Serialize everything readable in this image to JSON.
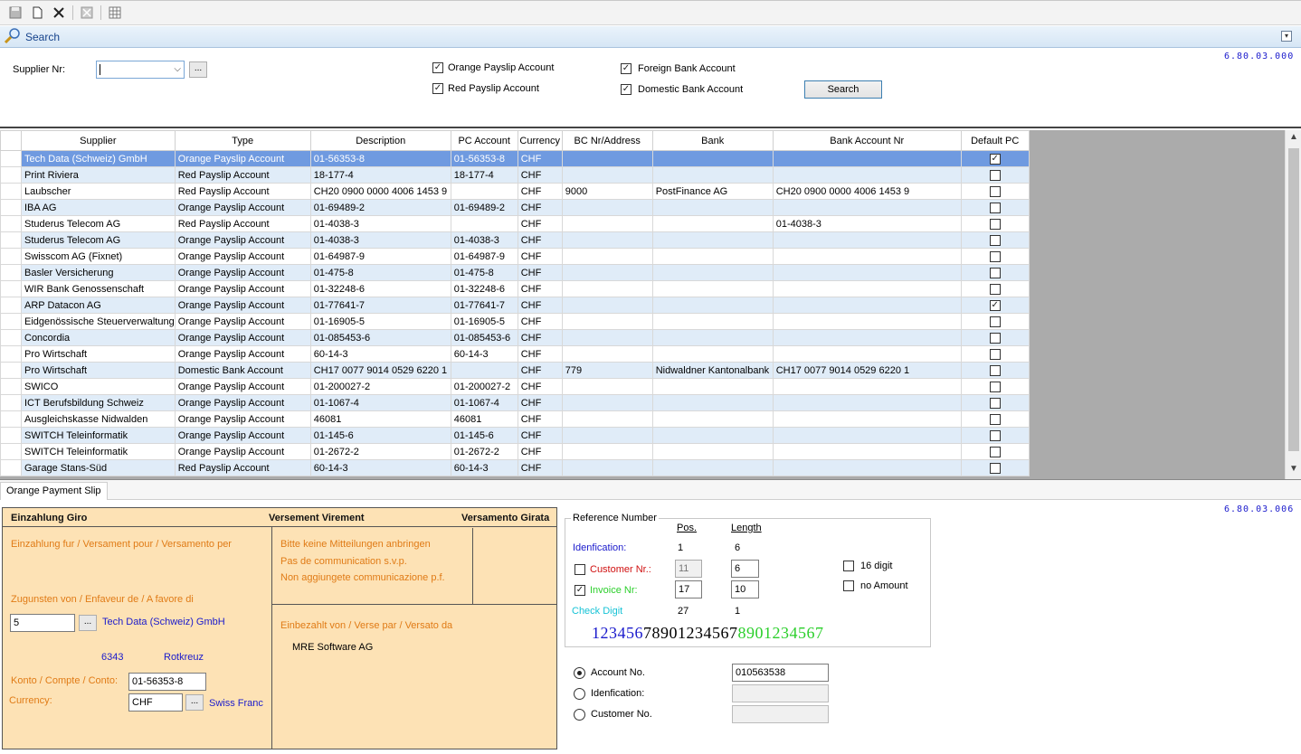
{
  "toolbar": {
    "icons": [
      "save-icon",
      "new-document-icon",
      "delete-icon",
      "cancel-icon",
      "grid-icon"
    ]
  },
  "search": {
    "title": "Search",
    "version": "6.80.03.000",
    "supplier_label": "Supplier Nr:",
    "supplier_value": "",
    "dots": "...",
    "options": [
      {
        "label": "Orange Payslip Account",
        "checked": true
      },
      {
        "label": "Red Payslip Account",
        "checked": true
      },
      {
        "label": "Foreign Bank Account",
        "checked": true
      },
      {
        "label": "Domestic Bank Account",
        "checked": true
      }
    ],
    "search_button": "Search"
  },
  "grid": {
    "columns": [
      "Supplier",
      "Type",
      "Description",
      "PC Account",
      "Currency",
      "BC Nr/Address",
      "Bank",
      "Bank Account Nr",
      "Default PC"
    ],
    "rows": [
      {
        "supplier": "Tech Data (Schweiz) GmbH",
        "type": "Orange Payslip Account",
        "description": "01-56353-8",
        "pc": "01-56353-8",
        "currency": "CHF",
        "bc": "",
        "bank": "",
        "bank_acc": "",
        "default": true
      },
      {
        "supplier": "Print Riviera",
        "type": "Red Payslip Account",
        "description": "18-177-4",
        "pc": "18-177-4",
        "currency": "CHF",
        "bc": "",
        "bank": "",
        "bank_acc": "",
        "default": false
      },
      {
        "supplier": "Laubscher",
        "type": "Red Payslip Account",
        "description": "CH20 0900 0000 4006 1453 9",
        "pc": "",
        "currency": "CHF",
        "bc": "9000",
        "bank": "PostFinance AG",
        "bank_acc": "CH20 0900 0000 4006 1453 9",
        "default": false
      },
      {
        "supplier": "IBA AG",
        "type": "Orange Payslip Account",
        "description": "01-69489-2",
        "pc": "01-69489-2",
        "currency": "CHF",
        "bc": "",
        "bank": "",
        "bank_acc": "",
        "default": false
      },
      {
        "supplier": "Studerus Telecom AG",
        "type": "Red Payslip Account",
        "description": "01-4038-3",
        "pc": "",
        "currency": "CHF",
        "bc": "",
        "bank": "",
        "bank_acc": "01-4038-3",
        "default": false
      },
      {
        "supplier": "Studerus Telecom AG",
        "type": "Orange Payslip Account",
        "description": "01-4038-3",
        "pc": "01-4038-3",
        "currency": "CHF",
        "bc": "",
        "bank": "",
        "bank_acc": "",
        "default": false
      },
      {
        "supplier": "Swisscom AG (Fixnet)",
        "type": "Orange Payslip Account",
        "description": "01-64987-9",
        "pc": "01-64987-9",
        "currency": "CHF",
        "bc": "",
        "bank": "",
        "bank_acc": "",
        "default": false
      },
      {
        "supplier": "Basler Versicherung",
        "type": "Orange Payslip Account",
        "description": "01-475-8",
        "pc": "01-475-8",
        "currency": "CHF",
        "bc": "",
        "bank": "",
        "bank_acc": "",
        "default": false
      },
      {
        "supplier": "WIR Bank Genossenschaft",
        "type": "Orange Payslip Account",
        "description": "01-32248-6",
        "pc": "01-32248-6",
        "currency": "CHF",
        "bc": "",
        "bank": "",
        "bank_acc": "",
        "default": false
      },
      {
        "supplier": "ARP Datacon AG",
        "type": "Orange Payslip Account",
        "description": "01-77641-7",
        "pc": "01-77641-7",
        "currency": "CHF",
        "bc": "",
        "bank": "",
        "bank_acc": "",
        "default": true
      },
      {
        "supplier": "Eidgenössische Steuerverwaltung",
        "type": "Orange Payslip Account",
        "description": "01-16905-5",
        "pc": "01-16905-5",
        "currency": "CHF",
        "bc": "",
        "bank": "",
        "bank_acc": "",
        "default": false
      },
      {
        "supplier": "Concordia",
        "type": "Orange Payslip Account",
        "description": "01-085453-6",
        "pc": "01-085453-6",
        "currency": "CHF",
        "bc": "",
        "bank": "",
        "bank_acc": "",
        "default": false
      },
      {
        "supplier": "Pro Wirtschaft",
        "type": "Orange Payslip Account",
        "description": "60-14-3",
        "pc": "60-14-3",
        "currency": "CHF",
        "bc": "",
        "bank": "",
        "bank_acc": "",
        "default": false
      },
      {
        "supplier": "Pro Wirtschaft",
        "type": "Domestic Bank Account",
        "description": "CH17 0077 9014 0529 6220 1",
        "pc": "",
        "currency": "CHF",
        "bc": "779",
        "bank": "Nidwaldner Kantonalbank",
        "bank_acc": "CH17 0077 9014 0529 6220 1",
        "default": false
      },
      {
        "supplier": "SWICO",
        "type": "Orange Payslip Account",
        "description": "01-200027-2",
        "pc": "01-200027-2",
        "currency": "CHF",
        "bc": "",
        "bank": "",
        "bank_acc": "",
        "default": false
      },
      {
        "supplier": "ICT Berufsbildung Schweiz",
        "type": "Orange Payslip Account",
        "description": "01-1067-4",
        "pc": "01-1067-4",
        "currency": "CHF",
        "bc": "",
        "bank": "",
        "bank_acc": "",
        "default": false
      },
      {
        "supplier": "Ausgleichskasse Nidwalden",
        "type": "Orange Payslip Account",
        "description": "46081",
        "pc": "46081",
        "currency": "CHF",
        "bc": "",
        "bank": "",
        "bank_acc": "",
        "default": false
      },
      {
        "supplier": "SWITCH Teleinformatik",
        "type": "Orange Payslip Account",
        "description": "01-145-6",
        "pc": "01-145-6",
        "currency": "CHF",
        "bc": "",
        "bank": "",
        "bank_acc": "",
        "default": false
      },
      {
        "supplier": "SWITCH Teleinformatik",
        "type": "Orange Payslip Account",
        "description": "01-2672-2",
        "pc": "01-2672-2",
        "currency": "CHF",
        "bc": "",
        "bank": "",
        "bank_acc": "",
        "default": false
      },
      {
        "supplier": "Garage Stans-Süd",
        "type": "Red Payslip Account",
        "description": "60-14-3",
        "pc": "60-14-3",
        "currency": "CHF",
        "bc": "",
        "bank": "",
        "bank_acc": "",
        "default": false
      }
    ]
  },
  "tab": {
    "label": "Orange Payment Slip"
  },
  "slip": {
    "version": "6.80.03.006",
    "header_left": "Einzahlung Giro",
    "header_mid": "Versement Virement",
    "header_right": "Versamento Girata",
    "einzahlung_fur": "Einzahlung fur / Versament pour / Versamento per",
    "zugunsten": "Zugunsten von / Enfaveur de / A favore di",
    "supplier_nr": "5",
    "supplier_name": "Tech Data (Schweiz) GmbH",
    "zip": "6343",
    "city": "Rotkreuz",
    "konto_label": "Konto / Compte / Conto:",
    "konto_value": "01-56353-8",
    "currency_label": "Currency:",
    "currency_value": "CHF",
    "currency_name": "Swiss Franc",
    "dots": "...",
    "no_messages": [
      "Bitte keine Mitteilungen anbringen",
      "Pas de communication s.v.p.",
      "Non aggiungete communicazione p.f."
    ],
    "einbezahlt": "Einbezahlt von / Verse par / Versato da",
    "payer": "MRE Software AG"
  },
  "reference": {
    "title": "Reference Number",
    "pos_header": "Pos.",
    "length_header": "Length",
    "idenfication_label": "Idenfication:",
    "idenfication_pos": "1",
    "idenfication_len": "6",
    "customer_label": "Customer Nr.:",
    "customer_checked": false,
    "customer_pos": "11",
    "customer_len": "6",
    "invoice_label": "Invoice Nr:",
    "invoice_checked": true,
    "invoice_pos": "17",
    "invoice_len": "10",
    "check_label": "Check Digit",
    "check_pos": "27",
    "check_len": "1",
    "digit16_label": "16 digit",
    "no_amount_label": "no Amount",
    "digits_blue": "123456",
    "digits_black": "78901234567",
    "digits_green": "8901234567",
    "account_no_label": "Account No.",
    "account_no_value": "010563538",
    "idenfication_radio_label": "Idenfication:",
    "customer_no_label": "Customer No."
  },
  "colors": {
    "selection": "#6f9ae0",
    "row_alt": "#e0ecf8",
    "slip_bg": "#fde2b5",
    "slip_text": "#e07b16",
    "blue_text": "#1a1acc",
    "customer_red": "#d01010",
    "invoice_green": "#2bcf2b",
    "check_cyan": "#17c3d6"
  }
}
